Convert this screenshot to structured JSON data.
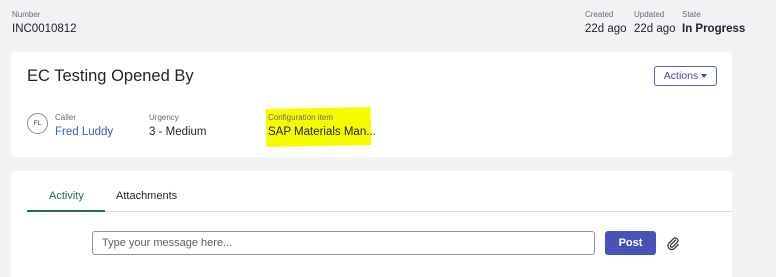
{
  "header": {
    "number_label": "Number",
    "number_value": "INC0010812",
    "created_label": "Created",
    "created_value": "22d ago",
    "updated_label": "Updated",
    "updated_value": "22d ago",
    "state_label": "State",
    "state_value": "In Progress"
  },
  "record": {
    "title": "EC Testing Opened By",
    "actions_label": "Actions",
    "caller": {
      "initials": "FL",
      "label": "Caller",
      "value": "Fred Luddy"
    },
    "urgency": {
      "label": "Urgency",
      "value": "3 - Medium"
    },
    "config_item": {
      "label": "Configuration item",
      "value": "SAP Materials Man..."
    },
    "highlight_color": "#f6fb00"
  },
  "activity": {
    "tabs": [
      "Activity",
      "Attachments"
    ],
    "active_tab": "Activity",
    "message_placeholder": "Type your message here...",
    "post_label": "Post",
    "accent_color": "#1b6f4f",
    "post_color": "#4a52b8"
  }
}
